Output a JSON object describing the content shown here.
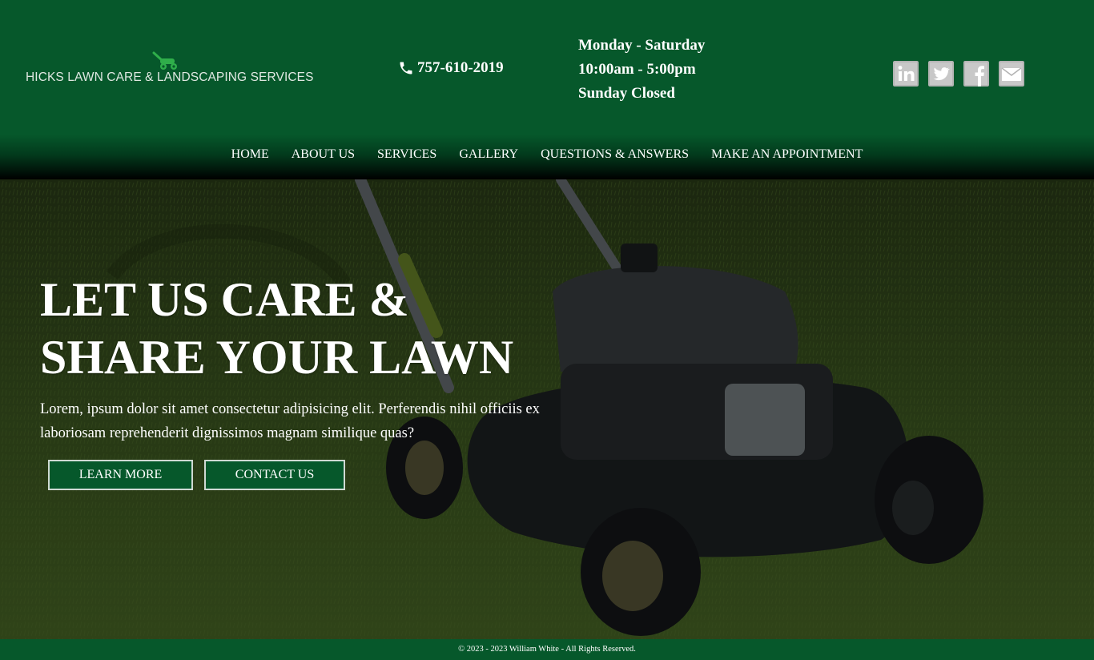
{
  "brand": {
    "name": "HICKS LAWN CARE & LANDSCAPING SERVICES",
    "logo_icon": "lawn-mower-icon",
    "accent": "#2fae4a"
  },
  "contact": {
    "phone": "757-610-2019",
    "phone_icon": "phone-icon"
  },
  "hours": {
    "line1": "Monday - Saturday",
    "line2": "10:00am - 5:00pm",
    "line3": "Sunday Closed"
  },
  "social": [
    {
      "name": "linkedin-icon"
    },
    {
      "name": "twitter-icon"
    },
    {
      "name": "facebook-icon"
    },
    {
      "name": "email-icon"
    }
  ],
  "nav": {
    "items": [
      "HOME",
      "ABOUT US",
      "SERVICES",
      "GALLERY",
      "QUESTIONS & ANSWERS",
      "MAKE AN APPOINTMENT"
    ]
  },
  "hero": {
    "title_line1": "LET US CARE &",
    "title_line2": "SHARE YOUR LAWN",
    "text": "Lorem, ipsum dolor sit amet consectetur adipisicing elit. Perferendis nihil officiis ex laboriosam reprehenderit dignissimos magnam similique quas?",
    "learn_more": "LEARN MORE",
    "contact_us": "CONTACT US"
  },
  "footer": {
    "copyright": "© 2023 - 2023 William White - All Rights Reserved."
  },
  "colors": {
    "primary": "#06582b",
    "nav_dark": "#000000",
    "text": "#ffffff"
  }
}
